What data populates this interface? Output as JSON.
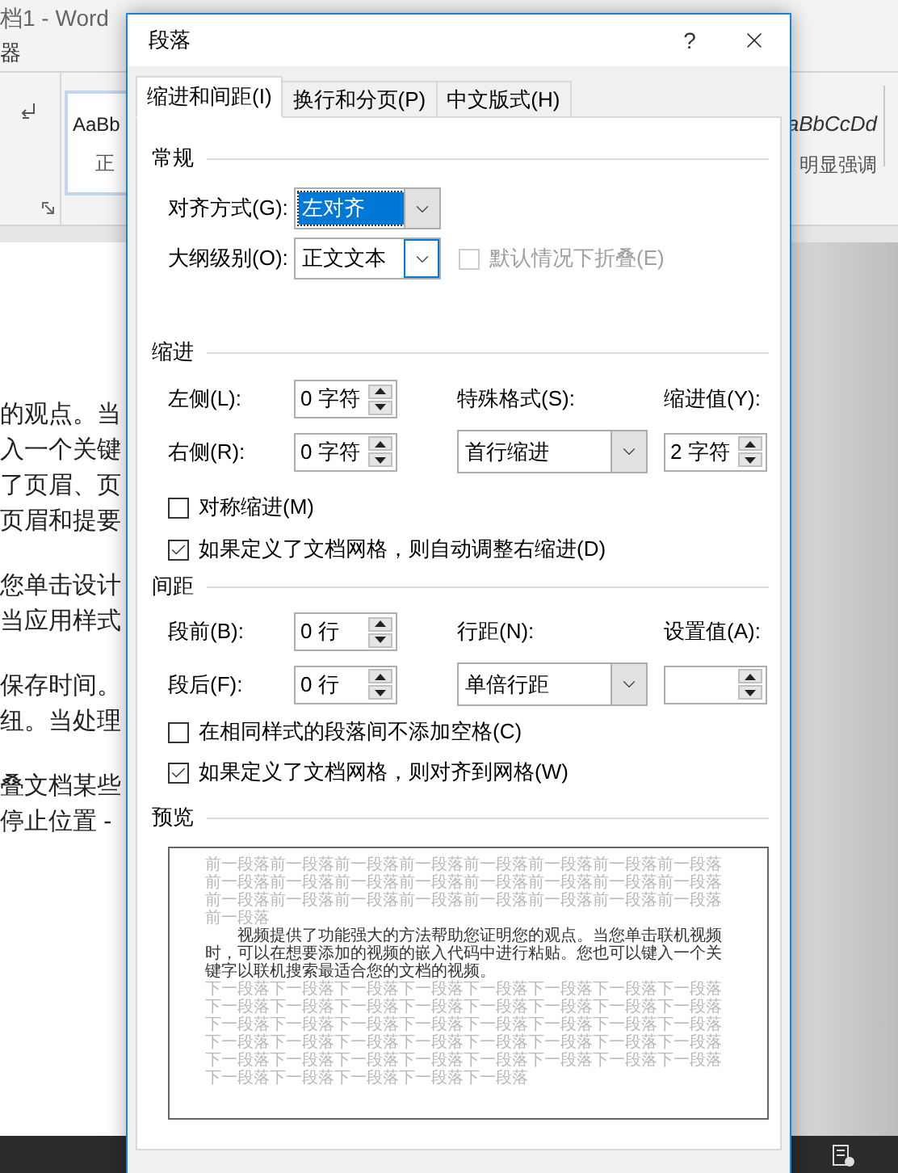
{
  "word_window": {
    "title": "档1 - Word",
    "menu_fragment": "器",
    "styles": [
      {
        "sample": "AaBb",
        "name": "正",
        "selected": true
      },
      {
        "sample": "aBbCcDd",
        "name": "明显强调",
        "selected": false
      }
    ],
    "document_paragraphs": [
      [
        "的观点。当",
        "入一个关键",
        "了页眉、页",
        "页眉和提要"
      ],
      [
        "您单击设计",
        "当应用样式"
      ],
      [
        "保存时间。",
        "纽。当处理"
      ],
      [
        "叠文档某些",
        "停止位置 -"
      ]
    ]
  },
  "dialog": {
    "title": "段落",
    "help": "?",
    "tabs": [
      {
        "label": "缩进和间距(I)",
        "selected": true
      },
      {
        "label": "换行和分页(P)",
        "selected": false
      },
      {
        "label": "中文版式(H)",
        "selected": false
      }
    ],
    "general": {
      "title": "常规",
      "alignment": {
        "label": "对齐方式(G):",
        "value": "左对齐",
        "focused": true,
        "hovered": false
      },
      "outline_level": {
        "label": "大纲级别(O):",
        "value": "正文文本",
        "focused": false,
        "hovered": true
      },
      "collapse_by_default": {
        "label": "默认情况下折叠(E)",
        "checked": false,
        "disabled": true
      }
    },
    "indentation": {
      "title": "缩进",
      "left": {
        "label": "左侧(L):",
        "value": "0 字符"
      },
      "right": {
        "label": "右侧(R):",
        "value": "0 字符"
      },
      "special": {
        "label": "特殊格式(S):",
        "value": "首行缩进",
        "focused": false,
        "hovered": false
      },
      "by": {
        "label": "缩进值(Y):",
        "value": "2 字符"
      },
      "checkboxes": [
        {
          "label": "对称缩进(M)",
          "checked": false,
          "disabled": false
        },
        {
          "label": "如果定义了文档网格，则自动调整右缩进(D)",
          "checked": true,
          "disabled": false
        }
      ]
    },
    "spacing": {
      "title": "间距",
      "before": {
        "label": "段前(B):",
        "value": "0 行"
      },
      "after": {
        "label": "段后(F):",
        "value": "0 行"
      },
      "line_spacing": {
        "label": "行距(N):",
        "value": "单倍行距",
        "focused": false,
        "hovered": false
      },
      "at": {
        "label": "设置值(A):"
      },
      "checkboxes": [
        {
          "label": "在相同样式的段落间不添加空格(C)",
          "checked": false,
          "disabled": false
        },
        {
          "label": "如果定义了文档网格，则对齐到网格(W)",
          "checked": true,
          "disabled": false
        }
      ]
    },
    "preview": {
      "title": "预览",
      "previous_paragraph": "前一段落前一段落前一段落前一段落前一段落前一段落前一段落前一段落前一段落前一段落前一段落前一段落前一段落前一段落前一段落前一段落前一段落前一段落前一段落前一段落前一段落前一段落前一段落前一段落前一段落",
      "sample_paragraph": "视频提供了功能强大的方法帮助您证明您的观点。当您单击联机视频时，可以在想要添加的视频的嵌入代码中进行粘贴。您也可以键入一个关键字以联机搜索最适合您的文档的视频。",
      "next_paragraph": "下一段落下一段落下一段落下一段落下一段落下一段落下一段落下一段落下一段落下一段落下一段落下一段落下一段落下一段落下一段落下一段落下一段落下一段落下一段落下一段落下一段落下一段落下一段落下一段落下一段落下一段落下一段落下一段落下一段落下一段落下一段落下一段落下一段落下一段落下一段落下一段落下一段落下一段落下一段落下一段落下一段落下一段落下一段落下一段落下一段落"
    }
  }
}
